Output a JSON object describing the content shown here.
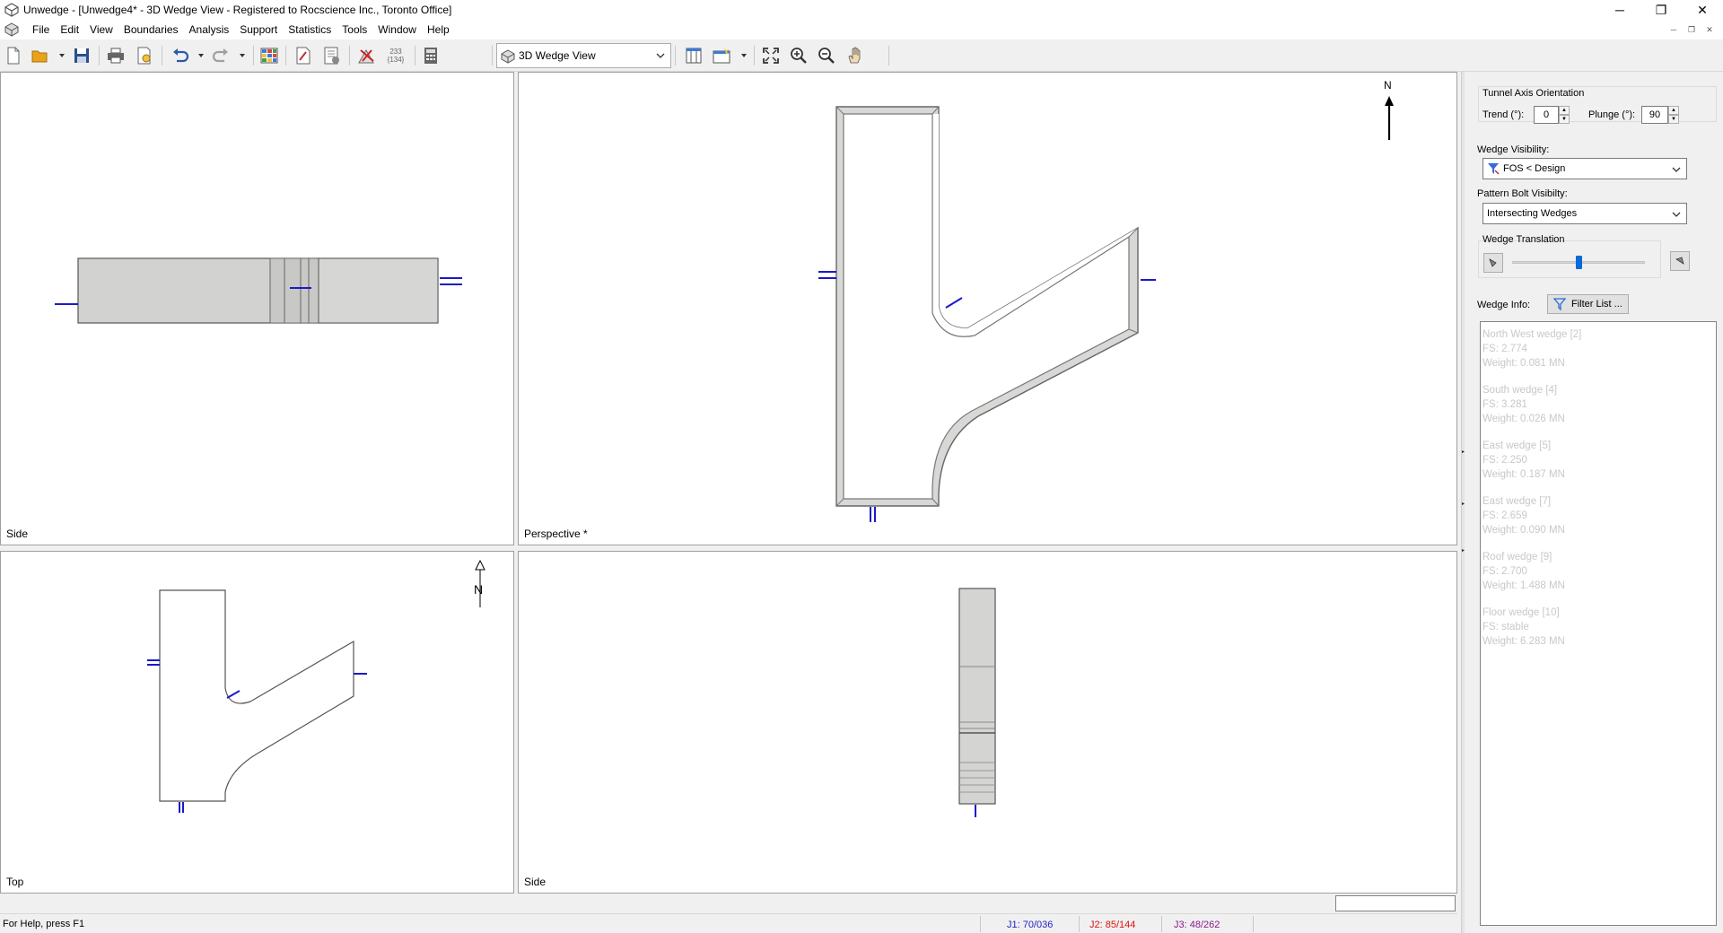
{
  "window": {
    "title": "Unwedge - [Unwedge4* - 3D Wedge View - Registered to Rocscience Inc., Toronto Office]",
    "minimize": "─",
    "restore": "❐",
    "close": "✕"
  },
  "menu": [
    "File",
    "Edit",
    "View",
    "Boundaries",
    "Analysis",
    "Support",
    "Statistics",
    "Tools",
    "Window",
    "Help"
  ],
  "toolbar": {
    "icons": [
      "new-icon",
      "open-icon",
      "save-icon",
      "print-icon",
      "print-preview-icon",
      "undo-icon",
      "redo-icon",
      "grid-icon",
      "edit-icon",
      "report-icon",
      "joints-icon",
      "joint-combination-icon",
      "calculator-icon",
      "layout-icon",
      "add-view-icon",
      "zoom-extents-icon",
      "zoom-in-icon",
      "zoom-out-icon",
      "pan-icon"
    ],
    "joint_combo_text_top": "233",
    "joint_combo_text_bottom": "{134}",
    "view_select": "3D Wedge View"
  },
  "viewports": {
    "top_left": "Side",
    "top_right": "Perspective *",
    "bottom_left": "Top",
    "bottom_right": "Side",
    "north_label": "N"
  },
  "panel": {
    "tunnel_axis": {
      "title": "Tunnel Axis Orientation",
      "trend_label": "Trend (°):",
      "trend_value": "0",
      "plunge_label": "Plunge (°):",
      "plunge_value": "90"
    },
    "wedge_visibility_label": "Wedge Visibility:",
    "wedge_visibility_value": "FOS < Design",
    "pattern_bolt_label": "Pattern Bolt Visibilty:",
    "pattern_bolt_value": "Intersecting Wedges",
    "wedge_translation_label": "Wedge Translation",
    "wedge_translation_level": 0.5,
    "wedge_info_label": "Wedge Info:",
    "filter_list_label": "Filter List ...",
    "wedges": [
      {
        "name": "North West wedge [2]",
        "fs": "FS: 2.774",
        "weight": "Weight: 0.081 MN"
      },
      {
        "name": "South wedge [4]",
        "fs": "FS: 3.281",
        "weight": "Weight: 0.026 MN"
      },
      {
        "name": "East wedge [5]",
        "fs": "FS: 2.250",
        "weight": "Weight: 0.187 MN"
      },
      {
        "name": "East wedge [7]",
        "fs": "FS: 2.659",
        "weight": "Weight: 0.090 MN"
      },
      {
        "name": "Roof wedge [9]",
        "fs": "FS: 2.700",
        "weight": "Weight: 1.488 MN"
      },
      {
        "name": "Floor wedge [10]",
        "fs": "FS: stable",
        "weight": "Weight: 6.283 MN"
      }
    ]
  },
  "status": {
    "help": "For Help, press F1",
    "j1": "J1: 70/036",
    "j2": "J2: 85/144",
    "j3": "J3: 48/262",
    "j1_color": "#1f1fc8",
    "j2_color": "#e01010",
    "j3_color": "#8a1a8a"
  }
}
